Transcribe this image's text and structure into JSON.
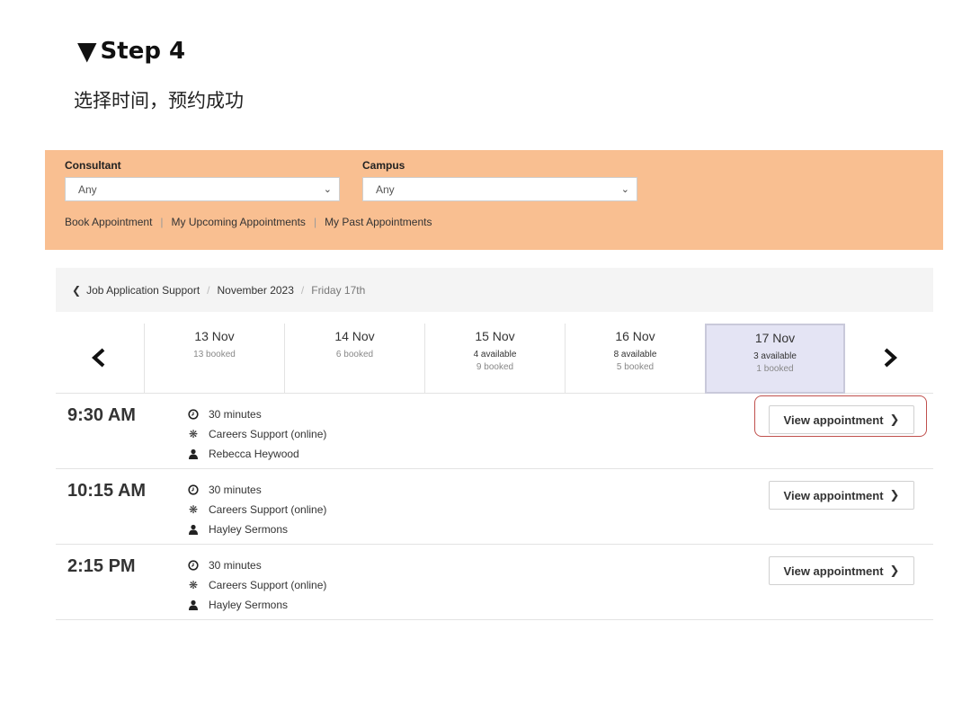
{
  "heading": {
    "marker": "▼",
    "title": "Step 4",
    "subtitle": "选择时间，预约成功"
  },
  "filters": {
    "consultant": {
      "label": "Consultant",
      "value": "Any"
    },
    "campus": {
      "label": "Campus",
      "value": "Any"
    },
    "links": [
      "Book Appointment",
      "My Upcoming Appointments",
      "My Past Appointments"
    ]
  },
  "breadcrumb": {
    "items": [
      "Job Application Support",
      "November 2023"
    ],
    "current": "Friday 17th"
  },
  "days": [
    {
      "date": "13 Nov",
      "available": "",
      "booked": "13 booked"
    },
    {
      "date": "14 Nov",
      "available": "",
      "booked": "6 booked"
    },
    {
      "date": "15 Nov",
      "available": "4 available",
      "booked": "9 booked"
    },
    {
      "date": "16 Nov",
      "available": "8 available",
      "booked": "5 booked"
    },
    {
      "date": "17 Nov",
      "available": "3 available",
      "booked": "1 booked"
    }
  ],
  "selected_day": "17 Nov",
  "slots": [
    {
      "time": "9:30 AM",
      "duration": "30 minutes",
      "service": "Careers Support (online)",
      "consultant": "Rebecca Heywood",
      "button": "View appointment"
    },
    {
      "time": "10:15 AM",
      "duration": "30 minutes",
      "service": "Careers Support (online)",
      "consultant": "Hayley Sermons",
      "button": "View appointment"
    },
    {
      "time": "2:15 PM",
      "duration": "30 minutes",
      "service": "Careers Support (online)",
      "consultant": "Hayley Sermons",
      "button": "View appointment"
    }
  ],
  "highlight_color": "#c0504d",
  "panel_color": "#f9bf91",
  "selected_day_color": "#e4e4f4"
}
